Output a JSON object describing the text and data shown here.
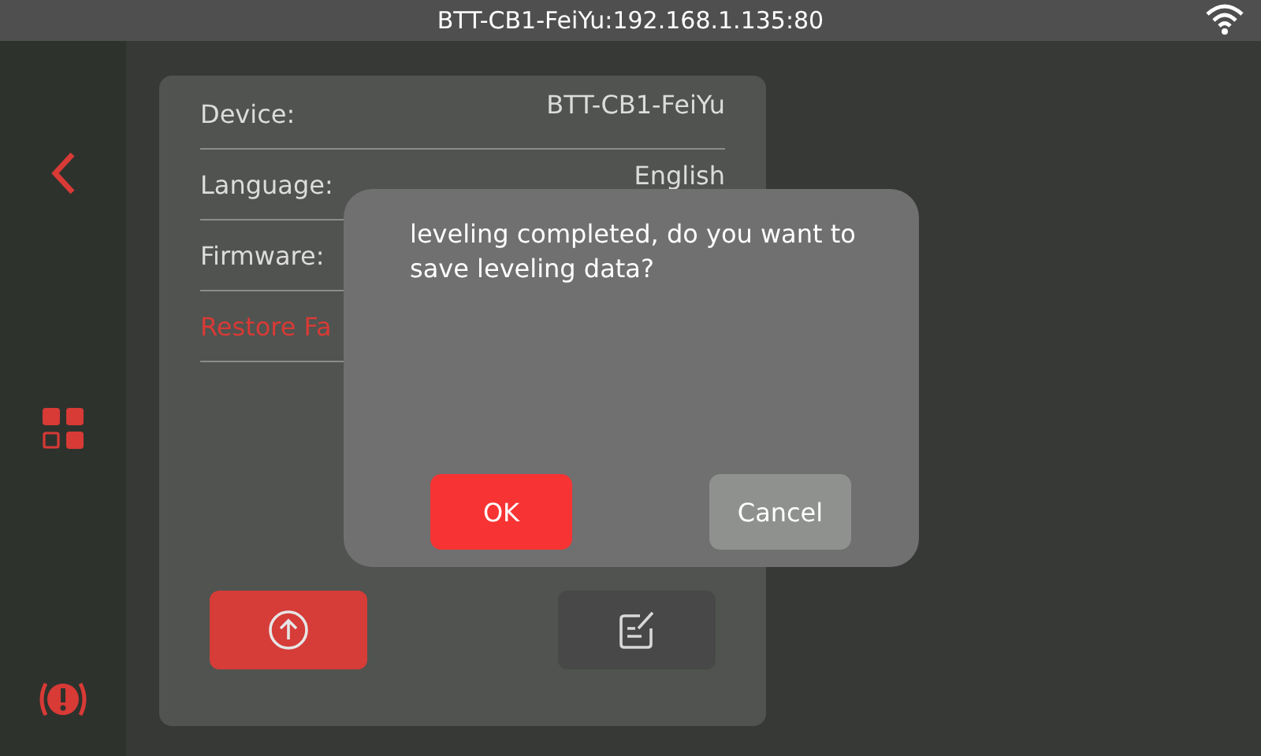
{
  "status_bar": {
    "title": "BTT-CB1-FeiYu:192.168.1.135:80"
  },
  "sidebar": {
    "items": [
      {
        "kind": "back",
        "selected": false
      },
      {
        "kind": "menu",
        "selected": false
      },
      {
        "kind": "alert",
        "selected": false
      }
    ]
  },
  "panel": {
    "rows": [
      {
        "label": "Device:",
        "value": "BTT-CB1-FeiYu",
        "kind": "info"
      },
      {
        "label": "Language:",
        "value": "English",
        "kind": "info"
      },
      {
        "label": "Firmware:",
        "kind": "info"
      },
      {
        "label": "Restore Fa",
        "kind": "danger"
      }
    ],
    "buttons": [
      {
        "kind": "upload"
      },
      {
        "kind": "edit"
      }
    ]
  },
  "dialog": {
    "message": "leveling completed, do you want to save leveling data?",
    "buttons": [
      {
        "label": "OK",
        "kind": "primary"
      },
      {
        "label": "Cancel",
        "kind": "secondary"
      }
    ]
  }
}
